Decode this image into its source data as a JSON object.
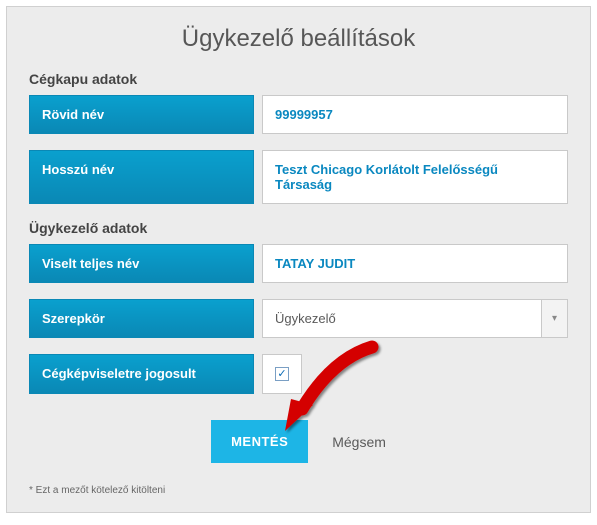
{
  "title": "Ügykezelő beállítások",
  "sections": {
    "company": {
      "heading": "Cégkapu adatok",
      "short_name_label": "Rövid név",
      "short_name_value": "99999957",
      "long_name_label": "Hosszú név",
      "long_name_value": "Teszt Chicago Korlátolt Felelősségű Társaság"
    },
    "agent": {
      "heading": "Ügykezelő adatok",
      "full_name_label": "Viselt teljes név",
      "full_name_value": "TATAY JUDIT",
      "role_label": "Szerepkör",
      "role_value": "Ügykezelő",
      "rep_label": "Cégképviseletre jogosult",
      "rep_checked": true
    }
  },
  "actions": {
    "save": "MENTÉS",
    "cancel": "Mégsem"
  },
  "footnote": "* Ezt a mezőt kötelező kitölteni",
  "checkmark": "✓",
  "dropdown_glyph": "▾"
}
